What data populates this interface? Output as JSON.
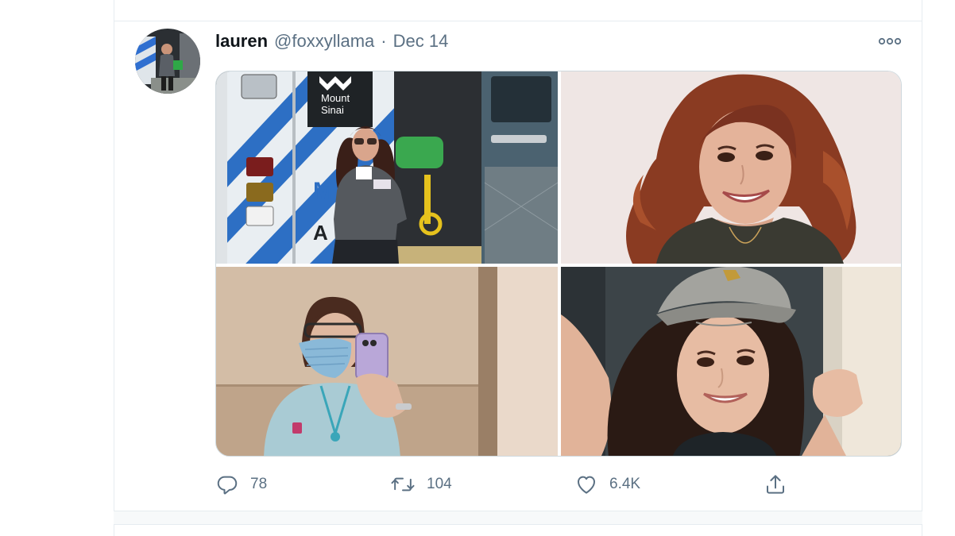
{
  "tweet": {
    "display_name": "lauren",
    "handle": "@foxxyllama",
    "separator": "·",
    "date": "Dec 14",
    "avatar_icon": "user-avatar-photo",
    "more_icon": "more-horizontal-icon",
    "photos": [
      {
        "name": "photo-ambulance",
        "sign_text": "Mount\nSinai",
        "sign_line1": "Mount",
        "sign_line2": "Sinai",
        "van_letters": [
          "M",
          "A"
        ]
      },
      {
        "name": "photo-portrait-smiling"
      },
      {
        "name": "photo-mirror-selfie-mask"
      },
      {
        "name": "photo-cap-selfie"
      }
    ],
    "actions": {
      "reply": {
        "icon": "reply-icon",
        "count": "78"
      },
      "retweet": {
        "icon": "retweet-icon",
        "count": "104"
      },
      "like": {
        "icon": "heart-icon",
        "count": "6.4K"
      },
      "share": {
        "icon": "share-icon"
      }
    }
  },
  "colors": {
    "text_primary": "#0f1419",
    "text_secondary": "#5b7083",
    "divider": "#e6ecf0",
    "accent": "#1da1f2"
  }
}
